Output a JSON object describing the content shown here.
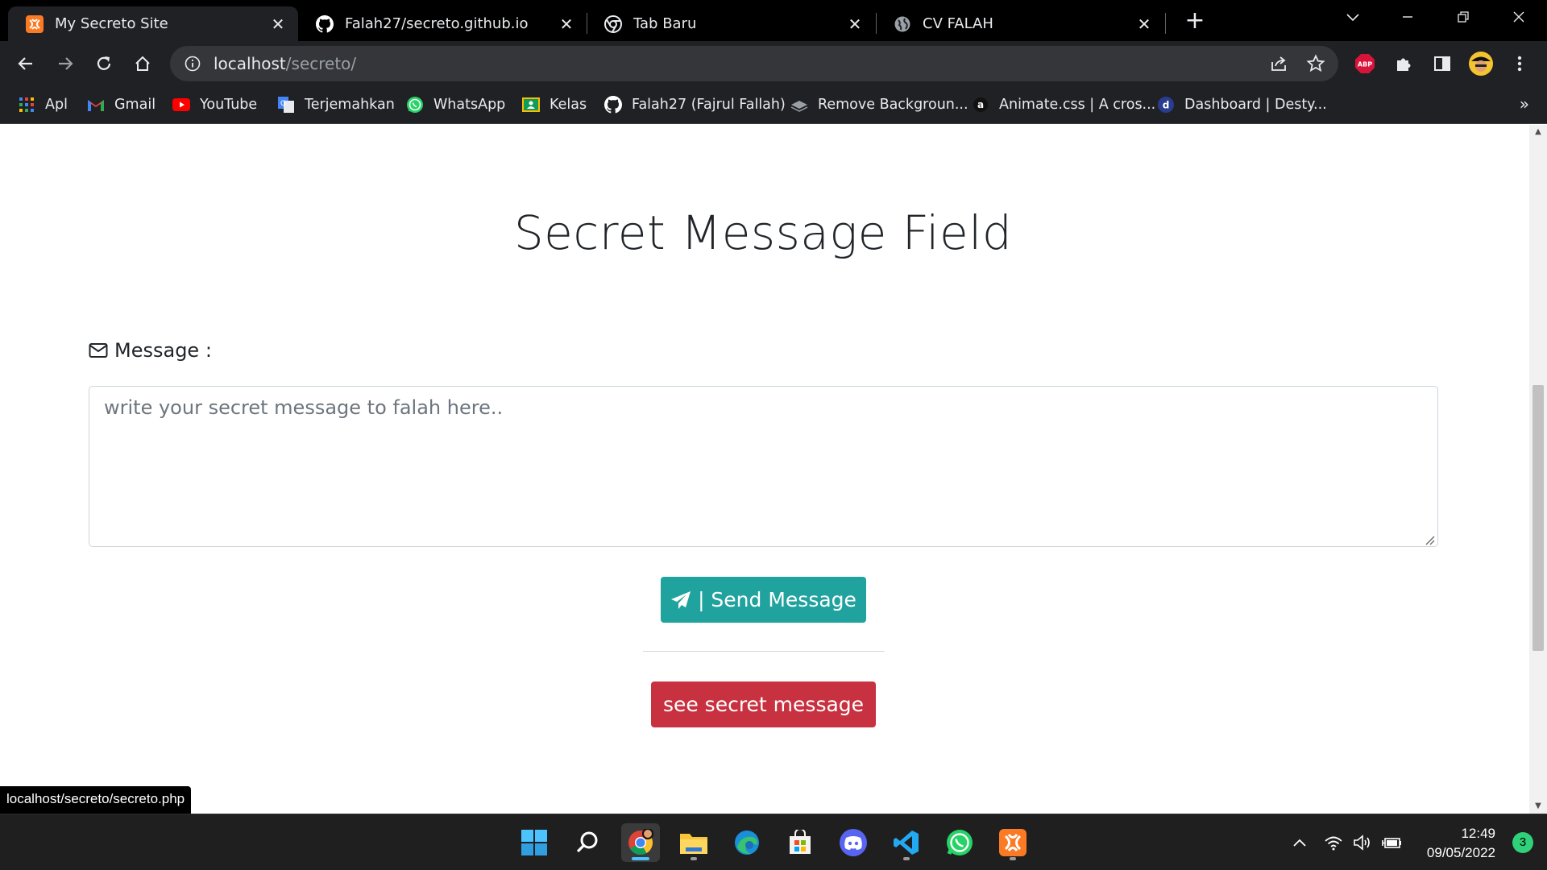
{
  "browser": {
    "tabs": [
      {
        "label": "My Secreto Site",
        "icon": "xampp-icon",
        "active": true
      },
      {
        "label": "Falah27/secreto.github.io",
        "icon": "github-icon",
        "active": false
      },
      {
        "label": "Tab Baru",
        "icon": "chrome-icon",
        "active": false
      },
      {
        "label": "CV FALAH",
        "icon": "globe-icon",
        "active": false
      }
    ],
    "url_host": "localhost",
    "url_path": "/secreto/",
    "extension_abp": "ABP",
    "bookmarks": [
      {
        "label": "Apl",
        "icon": "apps-grid-icon"
      },
      {
        "label": "Gmail",
        "icon": "gmail-icon"
      },
      {
        "label": "YouTube",
        "icon": "youtube-icon"
      },
      {
        "label": "Terjemahkan",
        "icon": "google-translate-icon"
      },
      {
        "label": "WhatsApp",
        "icon": "whatsapp-icon"
      },
      {
        "label": "Kelas",
        "icon": "classroom-icon"
      },
      {
        "label": "Falah27 (Fajrul Fallah)",
        "icon": "github-icon"
      },
      {
        "label": "Remove Backgroun...",
        "icon": "removebg-icon"
      },
      {
        "label": "Animate.css | A cros...",
        "icon": "animate-css-icon"
      },
      {
        "label": "Dashboard | Desty...",
        "icon": "desty-icon"
      }
    ],
    "bookmarks_more": "»",
    "status_url": "localhost/secreto/secreto.php"
  },
  "page": {
    "title": "Secret Message Field",
    "message_label": "Message :",
    "textarea_placeholder": "write your secret message to falah here..",
    "send_button": "| Send Message",
    "see_button": "see secret message"
  },
  "taskbar": {
    "time": "12:49",
    "date": "09/05/2022",
    "notification_count": "3"
  },
  "colors": {
    "send_button": "#20a39e",
    "see_button": "#c8313f",
    "chrome_dark": "#202124"
  }
}
